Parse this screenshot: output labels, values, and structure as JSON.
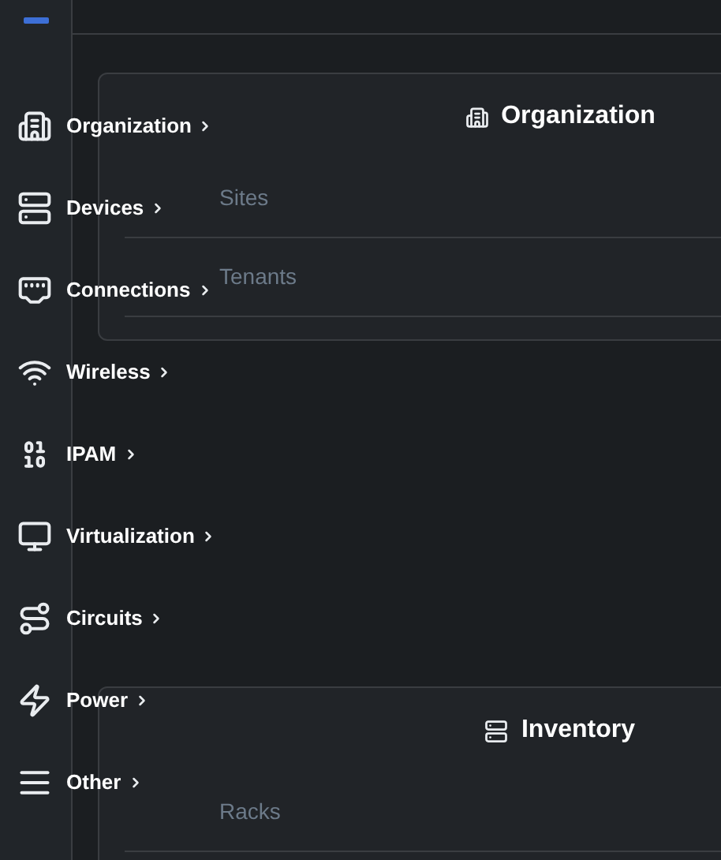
{
  "menu": [
    {
      "label": "Organization",
      "kind": "building"
    },
    {
      "label": "Devices",
      "kind": "server"
    },
    {
      "label": "Connections",
      "kind": "port"
    },
    {
      "label": "Wireless",
      "kind": "wifi"
    },
    {
      "label": "IPAM",
      "kind": "numbers"
    },
    {
      "label": "Virtualization",
      "kind": "monitor"
    },
    {
      "label": "Circuits",
      "kind": "route"
    },
    {
      "label": "Power",
      "kind": "bolt"
    },
    {
      "label": "Other",
      "kind": "lines"
    }
  ],
  "cards": [
    {
      "title": "Organization",
      "kind": "building",
      "items": [
        "Sites",
        "Tenants"
      ]
    },
    {
      "title": "Inventory",
      "kind": "server",
      "items": [
        "Racks"
      ]
    }
  ]
}
